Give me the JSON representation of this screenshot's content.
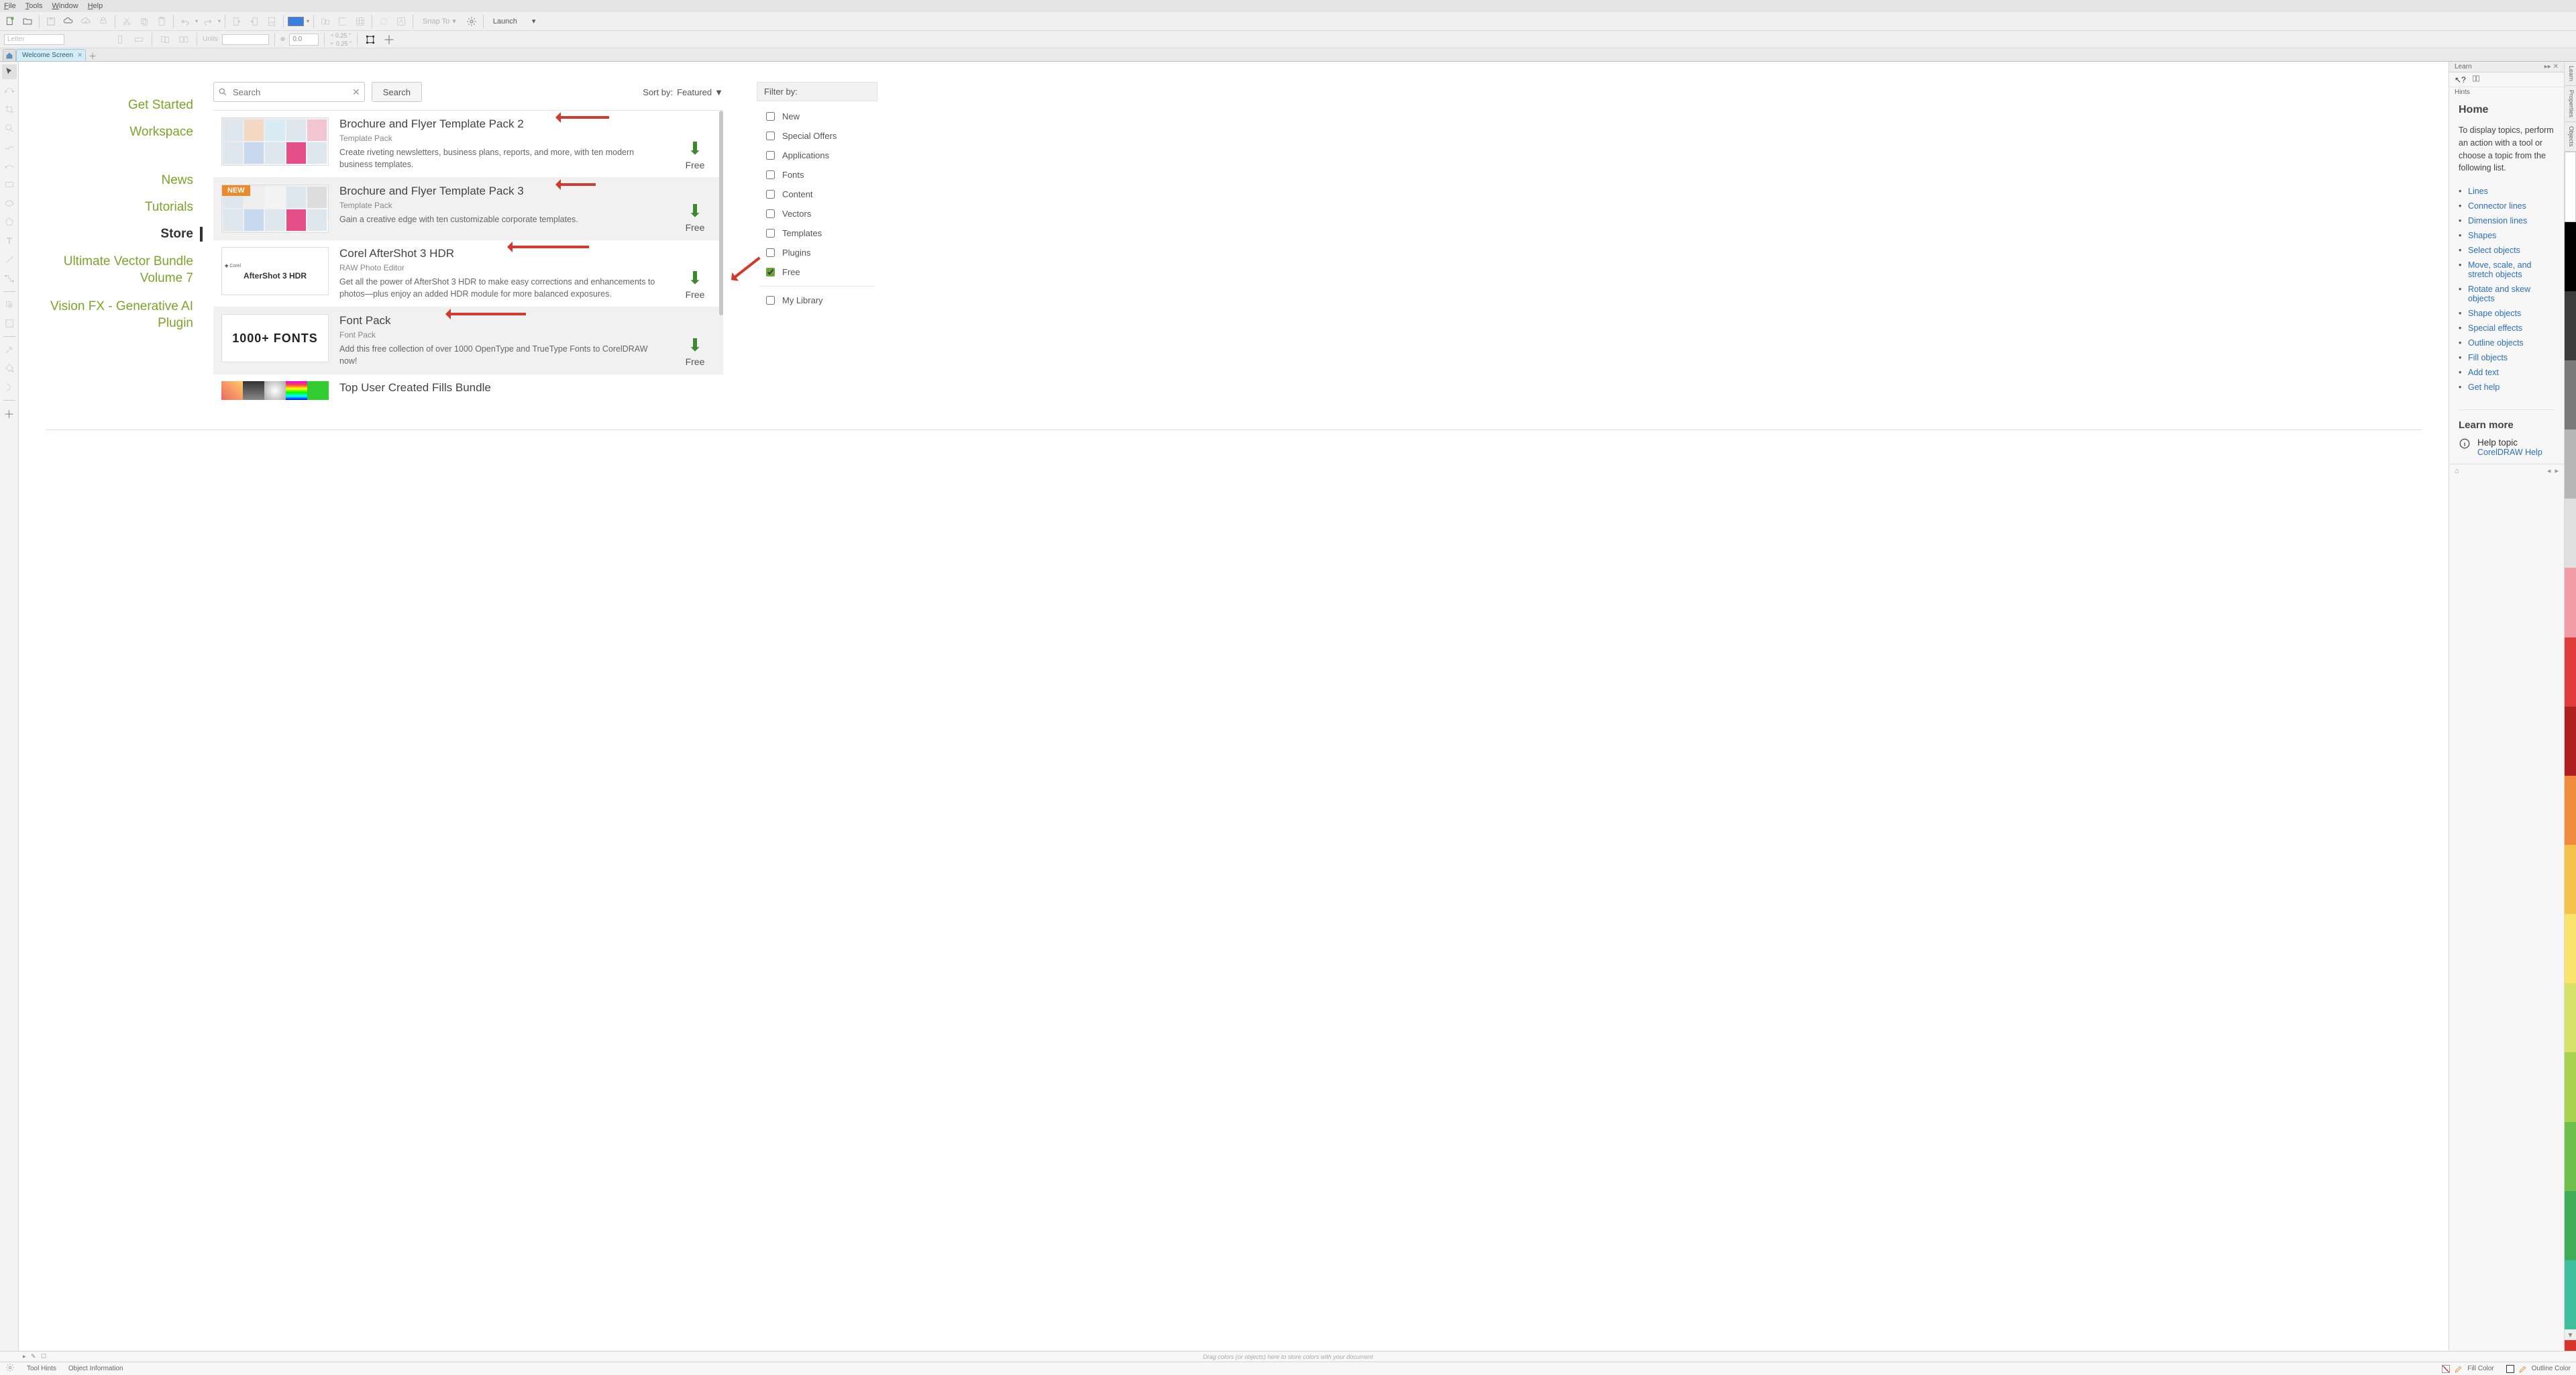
{
  "menubar": {
    "file": "File",
    "tools": "Tools",
    "window": "Window",
    "help": "Help"
  },
  "toolbar": {
    "launch_label": "Launch",
    "snap_label": "Snap To",
    "zoom_value": "0.0",
    "dim1": "0.25 \"",
    "dim2": "0.25 \"",
    "page_preset": "Letter",
    "units_label": "Units"
  },
  "tabs": {
    "welcome": "Welcome Screen"
  },
  "leftnav": {
    "get_started": "Get Started",
    "workspace": "Workspace",
    "news": "News",
    "tutorials": "Tutorials",
    "store": "Store",
    "bundle": "Ultimate Vector Bundle Volume 7",
    "visionfx": "Vision FX - Generative AI Plugin"
  },
  "store": {
    "search_placeholder": "Search",
    "search_btn": "Search",
    "sortby_label": "Sort by:",
    "sortby_value": "Featured",
    "items": [
      {
        "title": "Brochure and Flyer Template Pack 2",
        "type": "Template Pack",
        "desc": "Create riveting newsletters, business plans, reports, and more, with ten modern business templates.",
        "price": "Free",
        "new": false
      },
      {
        "title": "Brochure and Flyer Template Pack 3",
        "type": "Template Pack",
        "desc": "Gain a creative edge with ten customizable corporate templates.",
        "price": "Free",
        "new": true
      },
      {
        "title": "Corel AfterShot 3 HDR",
        "type": "RAW Photo Editor",
        "desc": "Get all the power of AfterShot 3 HDR to make easy corrections and enhancements to photos—plus enjoy an added HDR module for more balanced exposures.",
        "price": "Free",
        "new": false
      },
      {
        "title": "Font Pack",
        "type": "Font Pack",
        "desc": "Add this free collection of over 1000 OpenType and TrueType Fonts to CorelDRAW now!",
        "price": "Free",
        "new": false
      },
      {
        "title": "Top User Created Fills Bundle",
        "type": "",
        "desc": "",
        "price": "",
        "new": false
      }
    ]
  },
  "filters": {
    "header": "Filter by:",
    "options": [
      "New",
      "Special Offers",
      "Applications",
      "Fonts",
      "Content",
      "Vectors",
      "Templates",
      "Plugins",
      "Free"
    ],
    "checked": "Free",
    "mylibrary": "My Library"
  },
  "learn": {
    "tab": "Learn",
    "hints": "Hints",
    "home": "Home",
    "intro": "To display topics, perform an action with a tool or choose a topic from the following list.",
    "topics": [
      "Lines",
      "Connector lines",
      "Dimension lines",
      "Shapes",
      "Select objects",
      "Move, scale, and stretch objects",
      "Rotate and skew objects",
      "Shape objects",
      "Special effects",
      "Outline objects",
      "Fill objects",
      "Add text",
      "Get help"
    ],
    "learn_more": "Learn more",
    "help_topic": "Help topic",
    "help_link": "CorelDRAW Help"
  },
  "sidetabs": {
    "learn": "Learn",
    "properties": "Properties",
    "objects": "Objects"
  },
  "colorwell": "Drag colors (or objects) here to store colors with your document",
  "status": {
    "gear": "",
    "tool_hints": "Tool Hints",
    "obj_info": "Object Information",
    "fill": "Fill Color",
    "outline": "Outline Color"
  },
  "thumbs": {
    "aftershot": "AfterShot 3 HDR",
    "fontpack": "1000+ FONTS"
  }
}
